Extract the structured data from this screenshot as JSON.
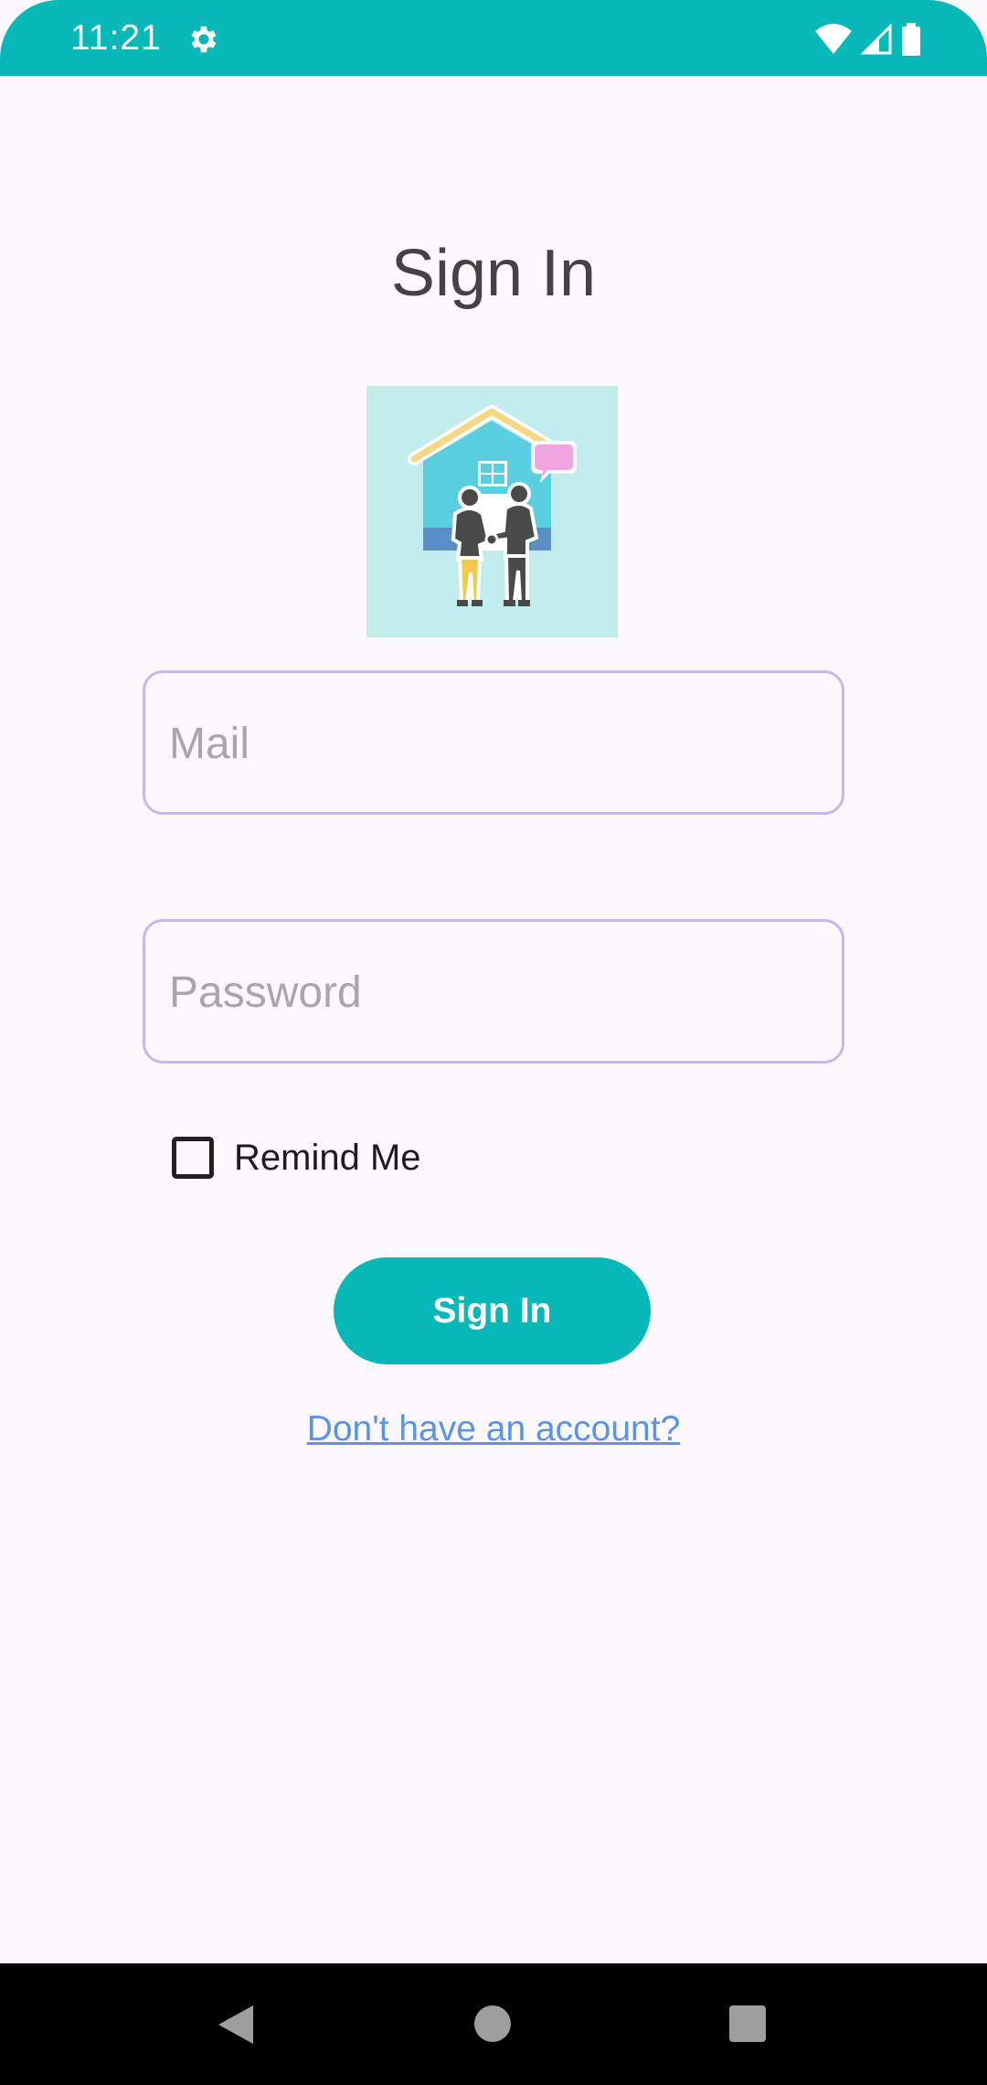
{
  "status_bar": {
    "time": "11:21",
    "icons": [
      "gear-icon",
      "wifi-icon",
      "signal-icon",
      "battery-icon"
    ],
    "color": "#06B8B8"
  },
  "page": {
    "title": "Sign In",
    "logo_icon": "house-handshake-logo"
  },
  "form": {
    "mail": {
      "placeholder": "Mail",
      "value": ""
    },
    "password": {
      "placeholder": "Password",
      "value": ""
    },
    "remind_me": {
      "label": "Remind Me",
      "checked": false
    },
    "submit_label": "Sign In",
    "account_link": "Don't have an account?"
  },
  "colors": {
    "accent": "#06B8B8",
    "field_border": "#C9B6EA",
    "link": "#5A93E8",
    "background": "#FDF8FB"
  },
  "nav_bar": {
    "icons": [
      "back-icon",
      "home-icon",
      "recents-icon"
    ]
  }
}
